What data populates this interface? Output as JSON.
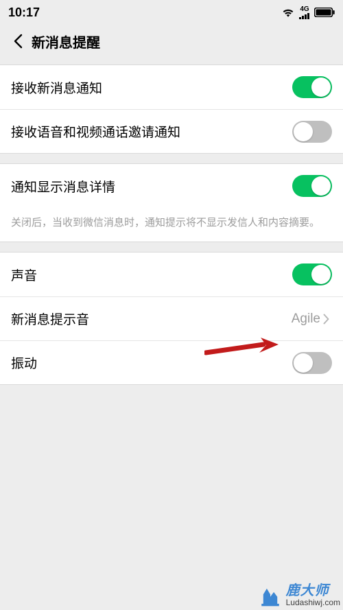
{
  "status": {
    "time": "10:17",
    "network": "4G"
  },
  "nav": {
    "title": "新消息提醒"
  },
  "groups": [
    {
      "rows": [
        {
          "label": "接收新消息通知",
          "type": "toggle",
          "state": "on"
        },
        {
          "label": "接收语音和视频通话邀请通知",
          "type": "toggle",
          "state": "off"
        }
      ]
    },
    {
      "rows": [
        {
          "label": "通知显示消息详情",
          "type": "toggle",
          "state": "on"
        }
      ],
      "desc": "关闭后，当收到微信消息时，通知提示将不显示发信人和内容摘要。"
    },
    {
      "rows": [
        {
          "label": "声音",
          "type": "toggle",
          "state": "on"
        },
        {
          "label": "新消息提示音",
          "type": "link",
          "value": "Agile"
        },
        {
          "label": "振动",
          "type": "toggle",
          "state": "off"
        }
      ]
    }
  ],
  "watermark": {
    "brand": "鹿大师",
    "url": "Ludashiwj.com"
  }
}
